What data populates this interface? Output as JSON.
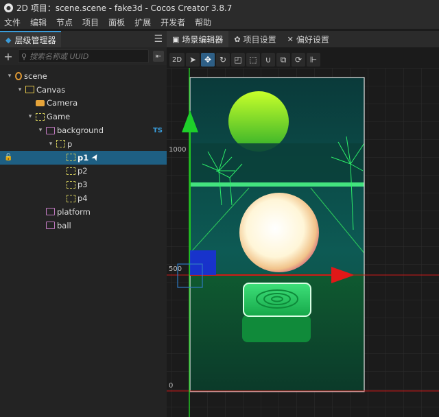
{
  "window": {
    "title": "2D 项目：scene.scene - fake3d - Cocos Creator 3.8.7"
  },
  "menu": [
    "文件",
    "编辑",
    "节点",
    "项目",
    "面板",
    "扩展",
    "开发者",
    "帮助"
  ],
  "hierarchy": {
    "tab_label": "层级管理器",
    "search_placeholder": "搜索名称或 UUID",
    "nodes": [
      {
        "label": "scene",
        "depth": 0,
        "icon": "scene-icon",
        "expanded": true
      },
      {
        "label": "Canvas",
        "depth": 1,
        "icon": "canvas-node-icon",
        "expanded": true
      },
      {
        "label": "Camera",
        "depth": 2,
        "icon": "camera-icon"
      },
      {
        "label": "Game",
        "depth": 2,
        "icon": "node-icon",
        "expanded": true
      },
      {
        "label": "background",
        "depth": 3,
        "icon": "sprite-icon",
        "expanded": true,
        "badge": "TS"
      },
      {
        "label": "p",
        "depth": 4,
        "icon": "node-icon",
        "expanded": true
      },
      {
        "label": "p1",
        "depth": 5,
        "icon": "node-icon",
        "selected": true
      },
      {
        "label": "p2",
        "depth": 5,
        "icon": "node-icon"
      },
      {
        "label": "p3",
        "depth": 5,
        "icon": "node-icon"
      },
      {
        "label": "p4",
        "depth": 5,
        "icon": "node-icon"
      },
      {
        "label": "platform",
        "depth": 3,
        "icon": "sprite-icon"
      },
      {
        "label": "ball",
        "depth": 3,
        "icon": "sprite-icon"
      }
    ]
  },
  "editor_tabs": [
    {
      "label": "场景编辑器",
      "active": true
    },
    {
      "label": "项目设置"
    },
    {
      "label": "偏好设置"
    }
  ],
  "scene_toolbar": {
    "mode_label": "2D",
    "tools": [
      "select-tool",
      "move-tool",
      "rotate-tool",
      "scale-tool",
      "rect-tool",
      "snap-tool",
      "crop-tool",
      "split-tool"
    ]
  },
  "viewport": {
    "y_labels": [
      "1000",
      "500",
      "0"
    ],
    "colors": {
      "grid": "#2a2a2a",
      "axis_x": "#d21a1a",
      "axis_y": "#22c322",
      "frame": "#e6e6e6"
    }
  }
}
